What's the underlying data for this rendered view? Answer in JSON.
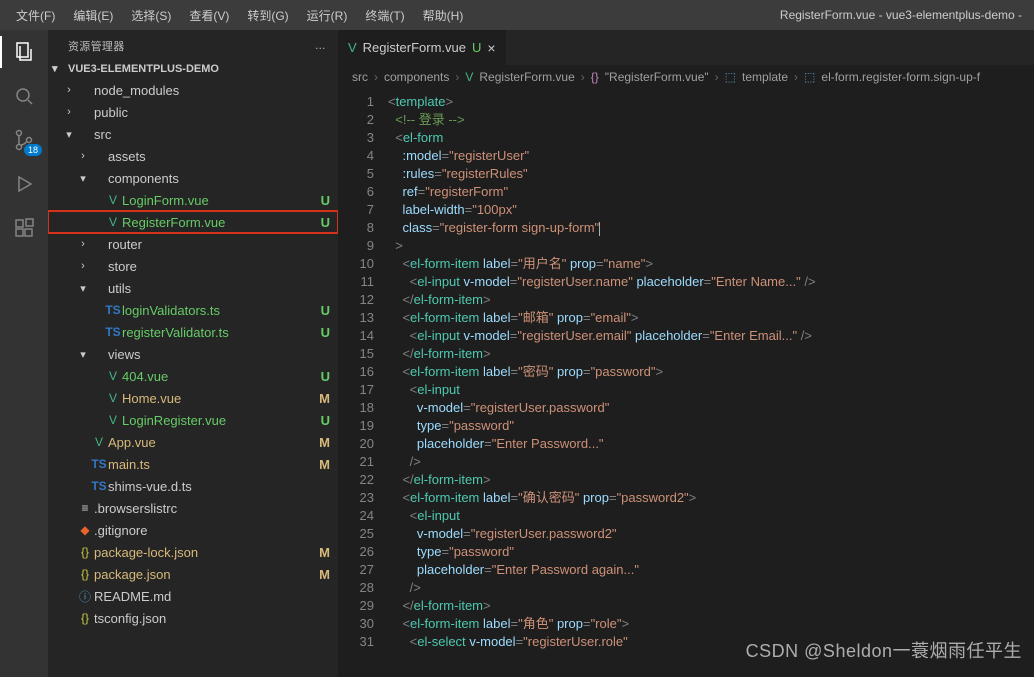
{
  "window": {
    "title": "RegisterForm.vue - vue3-elementplus-demo - "
  },
  "menu": [
    "文件(F)",
    "编辑(E)",
    "选择(S)",
    "查看(V)",
    "转到(G)",
    "运行(R)",
    "终端(T)",
    "帮助(H)"
  ],
  "activity": {
    "scm_badge": "18"
  },
  "sidebar": {
    "title": "资源管理器",
    "more": "…",
    "project": "VUE3-ELEMENTPLUS-DEMO",
    "tree": [
      {
        "depth": 0,
        "kind": "folder",
        "state": "closed",
        "label": "node_modules",
        "git": ""
      },
      {
        "depth": 0,
        "kind": "folder",
        "state": "closed",
        "label": "public",
        "git": ""
      },
      {
        "depth": 0,
        "kind": "folder",
        "state": "open",
        "label": "src",
        "git": ""
      },
      {
        "depth": 1,
        "kind": "folder",
        "state": "closed",
        "label": "assets",
        "git": ""
      },
      {
        "depth": 1,
        "kind": "folder",
        "state": "open",
        "label": "components",
        "git": ""
      },
      {
        "depth": 2,
        "kind": "vue",
        "state": "",
        "label": "LoginForm.vue",
        "git": "U"
      },
      {
        "depth": 2,
        "kind": "vue",
        "state": "",
        "label": "RegisterForm.vue",
        "git": "U",
        "hl": true
      },
      {
        "depth": 1,
        "kind": "folder",
        "state": "closed",
        "label": "router",
        "git": ""
      },
      {
        "depth": 1,
        "kind": "folder",
        "state": "closed",
        "label": "store",
        "git": ""
      },
      {
        "depth": 1,
        "kind": "folder",
        "state": "open",
        "label": "utils",
        "git": ""
      },
      {
        "depth": 2,
        "kind": "ts",
        "state": "",
        "label": "loginValidators.ts",
        "git": "U"
      },
      {
        "depth": 2,
        "kind": "ts",
        "state": "",
        "label": "registerValidator.ts",
        "git": "U"
      },
      {
        "depth": 1,
        "kind": "folder",
        "state": "open",
        "label": "views",
        "git": ""
      },
      {
        "depth": 2,
        "kind": "vue",
        "state": "",
        "label": "404.vue",
        "git": "U"
      },
      {
        "depth": 2,
        "kind": "vue",
        "state": "",
        "label": "Home.vue",
        "git": "M"
      },
      {
        "depth": 2,
        "kind": "vue",
        "state": "",
        "label": "LoginRegister.vue",
        "git": "U"
      },
      {
        "depth": 1,
        "kind": "vue",
        "state": "",
        "label": "App.vue",
        "git": "M"
      },
      {
        "depth": 1,
        "kind": "ts",
        "state": "",
        "label": "main.ts",
        "git": "M"
      },
      {
        "depth": 1,
        "kind": "ts",
        "state": "",
        "label": "shims-vue.d.ts",
        "git": ""
      },
      {
        "depth": 0,
        "kind": "file",
        "icon": "≡",
        "label": ".browserslistrc",
        "git": ""
      },
      {
        "depth": 0,
        "kind": "file",
        "icon": "◆",
        "iconColor": "#e8622b",
        "label": ".gitignore",
        "git": ""
      },
      {
        "depth": 0,
        "kind": "json",
        "state": "",
        "label": "package-lock.json",
        "git": "M"
      },
      {
        "depth": 0,
        "kind": "json",
        "state": "",
        "label": "package.json",
        "git": "M"
      },
      {
        "depth": 0,
        "kind": "file",
        "icon": "ⓘ",
        "iconColor": "#519aba",
        "label": "README.md",
        "git": ""
      },
      {
        "depth": 0,
        "kind": "json",
        "state": "",
        "label": "tsconfig.json",
        "git": ""
      }
    ]
  },
  "tab": {
    "icon": "V",
    "name": "RegisterForm.vue",
    "git": "U",
    "close": "×"
  },
  "breadcrumb": {
    "parts": [
      "src",
      "components",
      "RegisterForm.vue",
      "\"RegisterForm.vue\"",
      "template",
      "el-form.register-form.sign-up-f"
    ],
    "icons": [
      "",
      "",
      "V",
      "{}",
      "⬚",
      "⬚"
    ]
  },
  "code": {
    "first_line": 1,
    "lines": [
      [
        [
          "tag",
          "<"
        ],
        [
          "el",
          "template"
        ],
        [
          "tag",
          ">"
        ]
      ],
      [
        [
          "sp",
          "  "
        ],
        [
          "cmt",
          "<!-- 登录 -->"
        ]
      ],
      [
        [
          "sp",
          "  "
        ],
        [
          "tag",
          "<"
        ],
        [
          "el",
          "el-form"
        ]
      ],
      [
        [
          "sp",
          "    "
        ],
        [
          "attr",
          ":model"
        ],
        [
          "tag",
          "="
        ],
        [
          "str",
          "\"registerUser\""
        ]
      ],
      [
        [
          "sp",
          "    "
        ],
        [
          "attr",
          ":rules"
        ],
        [
          "tag",
          "="
        ],
        [
          "str",
          "\"registerRules\""
        ]
      ],
      [
        [
          "sp",
          "    "
        ],
        [
          "attr",
          "ref"
        ],
        [
          "tag",
          "="
        ],
        [
          "str",
          "\"registerForm\""
        ]
      ],
      [
        [
          "sp",
          "    "
        ],
        [
          "attr",
          "label-width"
        ],
        [
          "tag",
          "="
        ],
        [
          "str",
          "\"100px\""
        ]
      ],
      [
        [
          "sp",
          "    "
        ],
        [
          "attr",
          "class"
        ],
        [
          "tag",
          "="
        ],
        [
          "str",
          "\"register-form sign-up-form\""
        ],
        [
          "cursor",
          ""
        ]
      ],
      [
        [
          "sp",
          "  "
        ],
        [
          "tag",
          ">"
        ]
      ],
      [
        [
          "sp",
          "    "
        ],
        [
          "tag",
          "<"
        ],
        [
          "el",
          "el-form-item"
        ],
        [
          "sp",
          " "
        ],
        [
          "attr",
          "label"
        ],
        [
          "tag",
          "="
        ],
        [
          "str",
          "\"用户名\""
        ],
        [
          "sp",
          " "
        ],
        [
          "attr",
          "prop"
        ],
        [
          "tag",
          "="
        ],
        [
          "str",
          "\"name\""
        ],
        [
          "tag",
          ">"
        ]
      ],
      [
        [
          "sp",
          "      "
        ],
        [
          "tag",
          "<"
        ],
        [
          "el",
          "el-input"
        ],
        [
          "sp",
          " "
        ],
        [
          "attr",
          "v-model"
        ],
        [
          "tag",
          "="
        ],
        [
          "str",
          "\"registerUser.name\""
        ],
        [
          "sp",
          " "
        ],
        [
          "attr",
          "placeholder"
        ],
        [
          "tag",
          "="
        ],
        [
          "str",
          "\"Enter Name...\""
        ],
        [
          "sp",
          " "
        ],
        [
          "tag",
          "/>"
        ]
      ],
      [
        [
          "sp",
          "    "
        ],
        [
          "tag",
          "</"
        ],
        [
          "el",
          "el-form-item"
        ],
        [
          "tag",
          ">"
        ]
      ],
      [
        [
          "sp",
          "    "
        ],
        [
          "tag",
          "<"
        ],
        [
          "el",
          "el-form-item"
        ],
        [
          "sp",
          " "
        ],
        [
          "attr",
          "label"
        ],
        [
          "tag",
          "="
        ],
        [
          "str",
          "\"邮箱\""
        ],
        [
          "sp",
          " "
        ],
        [
          "attr",
          "prop"
        ],
        [
          "tag",
          "="
        ],
        [
          "str",
          "\"email\""
        ],
        [
          "tag",
          ">"
        ]
      ],
      [
        [
          "sp",
          "      "
        ],
        [
          "tag",
          "<"
        ],
        [
          "el",
          "el-input"
        ],
        [
          "sp",
          " "
        ],
        [
          "attr",
          "v-model"
        ],
        [
          "tag",
          "="
        ],
        [
          "str",
          "\"registerUser.email\""
        ],
        [
          "sp",
          " "
        ],
        [
          "attr",
          "placeholder"
        ],
        [
          "tag",
          "="
        ],
        [
          "str",
          "\"Enter Email...\""
        ],
        [
          "sp",
          " "
        ],
        [
          "tag",
          "/>"
        ]
      ],
      [
        [
          "sp",
          "    "
        ],
        [
          "tag",
          "</"
        ],
        [
          "el",
          "el-form-item"
        ],
        [
          "tag",
          ">"
        ]
      ],
      [
        [
          "sp",
          "    "
        ],
        [
          "tag",
          "<"
        ],
        [
          "el",
          "el-form-item"
        ],
        [
          "sp",
          " "
        ],
        [
          "attr",
          "label"
        ],
        [
          "tag",
          "="
        ],
        [
          "str",
          "\"密码\""
        ],
        [
          "sp",
          " "
        ],
        [
          "attr",
          "prop"
        ],
        [
          "tag",
          "="
        ],
        [
          "str",
          "\"password\""
        ],
        [
          "tag",
          ">"
        ]
      ],
      [
        [
          "sp",
          "      "
        ],
        [
          "tag",
          "<"
        ],
        [
          "el",
          "el-input"
        ]
      ],
      [
        [
          "sp",
          "        "
        ],
        [
          "attr",
          "v-model"
        ],
        [
          "tag",
          "="
        ],
        [
          "str",
          "\"registerUser.password\""
        ]
      ],
      [
        [
          "sp",
          "        "
        ],
        [
          "attr",
          "type"
        ],
        [
          "tag",
          "="
        ],
        [
          "str",
          "\"password\""
        ]
      ],
      [
        [
          "sp",
          "        "
        ],
        [
          "attr",
          "placeholder"
        ],
        [
          "tag",
          "="
        ],
        [
          "str",
          "\"Enter Password...\""
        ]
      ],
      [
        [
          "sp",
          "      "
        ],
        [
          "tag",
          "/>"
        ]
      ],
      [
        [
          "sp",
          "    "
        ],
        [
          "tag",
          "</"
        ],
        [
          "el",
          "el-form-item"
        ],
        [
          "tag",
          ">"
        ]
      ],
      [
        [
          "sp",
          "    "
        ],
        [
          "tag",
          "<"
        ],
        [
          "el",
          "el-form-item"
        ],
        [
          "sp",
          " "
        ],
        [
          "attr",
          "label"
        ],
        [
          "tag",
          "="
        ],
        [
          "str",
          "\"确认密码\""
        ],
        [
          "sp",
          " "
        ],
        [
          "attr",
          "prop"
        ],
        [
          "tag",
          "="
        ],
        [
          "str",
          "\"password2\""
        ],
        [
          "tag",
          ">"
        ]
      ],
      [
        [
          "sp",
          "      "
        ],
        [
          "tag",
          "<"
        ],
        [
          "el",
          "el-input"
        ]
      ],
      [
        [
          "sp",
          "        "
        ],
        [
          "attr",
          "v-model"
        ],
        [
          "tag",
          "="
        ],
        [
          "str",
          "\"registerUser.password2\""
        ]
      ],
      [
        [
          "sp",
          "        "
        ],
        [
          "attr",
          "type"
        ],
        [
          "tag",
          "="
        ],
        [
          "str",
          "\"password\""
        ]
      ],
      [
        [
          "sp",
          "        "
        ],
        [
          "attr",
          "placeholder"
        ],
        [
          "tag",
          "="
        ],
        [
          "str",
          "\"Enter Password again...\""
        ]
      ],
      [
        [
          "sp",
          "      "
        ],
        [
          "tag",
          "/>"
        ]
      ],
      [
        [
          "sp",
          "    "
        ],
        [
          "tag",
          "</"
        ],
        [
          "el",
          "el-form-item"
        ],
        [
          "tag",
          ">"
        ]
      ],
      [
        [
          "sp",
          "    "
        ],
        [
          "tag",
          "<"
        ],
        [
          "el",
          "el-form-item"
        ],
        [
          "sp",
          " "
        ],
        [
          "attr",
          "label"
        ],
        [
          "tag",
          "="
        ],
        [
          "str",
          "\"角色\""
        ],
        [
          "sp",
          " "
        ],
        [
          "attr",
          "prop"
        ],
        [
          "tag",
          "="
        ],
        [
          "str",
          "\"role\""
        ],
        [
          "tag",
          ">"
        ]
      ],
      [
        [
          "sp",
          "      "
        ],
        [
          "tag",
          "<"
        ],
        [
          "el",
          "el-select"
        ],
        [
          "sp",
          " "
        ],
        [
          "attr",
          "v-model"
        ],
        [
          "tag",
          "="
        ],
        [
          "str",
          "\"registerUser.role\""
        ]
      ]
    ]
  },
  "watermark": "CSDN @Sheldon一蓑烟雨任平生"
}
